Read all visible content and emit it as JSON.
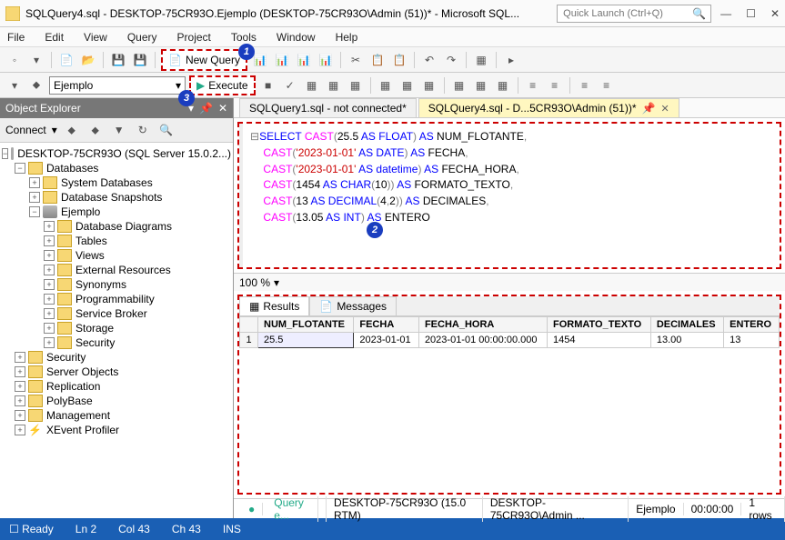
{
  "titlebar": {
    "title": "SQLQuery4.sql - DESKTOP-75CR93O.Ejemplo (DESKTOP-75CR93O\\Admin (51))* - Microsoft SQL...",
    "quick_launch_placeholder": "Quick Launch (Ctrl+Q)"
  },
  "menu": [
    "File",
    "Edit",
    "View",
    "Query",
    "Project",
    "Tools",
    "Window",
    "Help"
  ],
  "toolbar": {
    "new_query": "New Query",
    "execute": "Execute",
    "db_selected": "Ejemplo"
  },
  "callouts": {
    "c1": "1",
    "c2": "2",
    "c3": "3"
  },
  "object_explorer": {
    "title": "Object Explorer",
    "connect": "Connect",
    "server": "DESKTOP-75CR93O (SQL Server 15.0.2...)",
    "nodes": {
      "databases": "Databases",
      "system_db": "System Databases",
      "db_snapshots": "Database Snapshots",
      "ejemplo": "Ejemplo",
      "db_diagrams": "Database Diagrams",
      "tables": "Tables",
      "views": "Views",
      "ext_res": "External Resources",
      "synonyms": "Synonyms",
      "programmability": "Programmability",
      "service_broker": "Service Broker",
      "storage": "Storage",
      "security_db": "Security",
      "security": "Security",
      "server_objects": "Server Objects",
      "replication": "Replication",
      "polybase": "PolyBase",
      "management": "Management",
      "xevent": "XEvent Profiler"
    }
  },
  "tabs": [
    {
      "label": "SQLQuery1.sql - not connected*",
      "active": false
    },
    {
      "label": "SQLQuery4.sql - D...5CR93O\\Admin (51))*",
      "active": true
    }
  ],
  "sql": {
    "line1_a": "SELECT",
    "line1_b": " CAST",
    "line1_c": "(",
    "line1_d": "25.5",
    "line1_e": " AS ",
    "line1_f": "FLOAT",
    "line1_g": ")",
    "line1_h": " AS",
    "line1_i": " NUM_FLOTANTE",
    "line1_j": ",",
    "line2_a": "CAST",
    "line2_b": "(",
    "line2_c": "'2023-01-01'",
    "line2_d": " AS ",
    "line2_e": "DATE",
    "line2_f": ")",
    "line2_g": " AS",
    "line2_h": " FECHA",
    "line2_i": ",",
    "line3_a": "CAST",
    "line3_b": "(",
    "line3_c": "'2023-01-01'",
    "line3_d": " AS ",
    "line3_e": "datetime",
    "line3_f": ")",
    "line3_g": " AS",
    "line3_h": " FECHA_HORA",
    "line3_i": ",",
    "line4_a": "CAST",
    "line4_b": "(",
    "line4_c": "1454",
    "line4_d": " AS ",
    "line4_e": "CHAR",
    "line4_f": "(",
    "line4_g": "10",
    "line4_h": "))",
    "line4_i": " AS",
    "line4_j": " FORMATO_TEXTO",
    "line4_k": ",",
    "line5_a": "CAST",
    "line5_b": "(",
    "line5_c": "13",
    "line5_d": " AS ",
    "line5_e": "DECIMAL",
    "line5_f": "(",
    "line5_g": "4",
    "line5_h": ",",
    "line5_i": "2",
    "line5_j": "))",
    "line5_k": " AS",
    "line5_l": " DECIMALES",
    "line5_m": ",",
    "line6_a": "CAST",
    "line6_b": "(",
    "line6_c": "13.05",
    "line6_d": " AS ",
    "line6_e": "INT",
    "line6_f": ")",
    "line6_g": " AS",
    "line6_h": " ENTERO"
  },
  "zoom": "100 %",
  "results": {
    "tab_results": "Results",
    "tab_messages": "Messages",
    "columns": [
      "NUM_FLOTANTE",
      "FECHA",
      "FECHA_HORA",
      "FORMATO_TEXTO",
      "DECIMALES",
      "ENTERO"
    ],
    "rows": [
      {
        "n": "1",
        "c0": "25.5",
        "c1": "2023-01-01",
        "c2": "2023-01-01 00:00:00.000",
        "c3": "1454",
        "c4": "13.00",
        "c5": "13"
      }
    ]
  },
  "query_status": {
    "ok": "Query e...",
    "server": "DESKTOP-75CR93O (15.0 RTM)",
    "user": "DESKTOP-75CR93O\\Admin ...",
    "db": "Ejemplo",
    "time": "00:00:00",
    "rows": "1 rows"
  },
  "app_status": {
    "ready": "Ready",
    "ln": "Ln 2",
    "col": "Col 43",
    "ch": "Ch 43",
    "ins": "INS"
  }
}
